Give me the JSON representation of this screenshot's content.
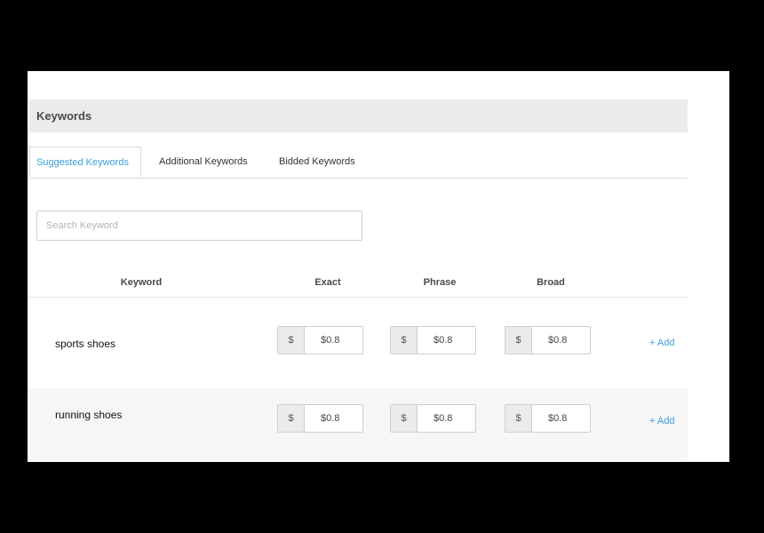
{
  "header": {
    "title": "Keywords"
  },
  "tabs": [
    {
      "label": "Suggested Keywords",
      "active": true
    },
    {
      "label": "Additional Keywords",
      "active": false
    },
    {
      "label": "Bidded Keywords",
      "active": false
    }
  ],
  "search": {
    "placeholder": "Search Keyword",
    "value": ""
  },
  "columns": {
    "keyword": "Keyword",
    "exact": "Exact",
    "phrase": "Phrase",
    "broad": "Broad"
  },
  "rows": [
    {
      "keyword": "sports shoes",
      "currency": "$",
      "exact": "$0.8",
      "phrase": "$0.8",
      "broad": "$0.8",
      "add_label": "+ Add"
    },
    {
      "keyword": "running shoes",
      "currency": "$",
      "exact": "$0.8",
      "phrase": "$0.8",
      "broad": "$0.8",
      "add_label": "+ Add"
    }
  ],
  "colors": {
    "accent": "#3b9fd9",
    "header_bg": "#ebebeb",
    "row_alt_bg": "#f6f6f6"
  }
}
